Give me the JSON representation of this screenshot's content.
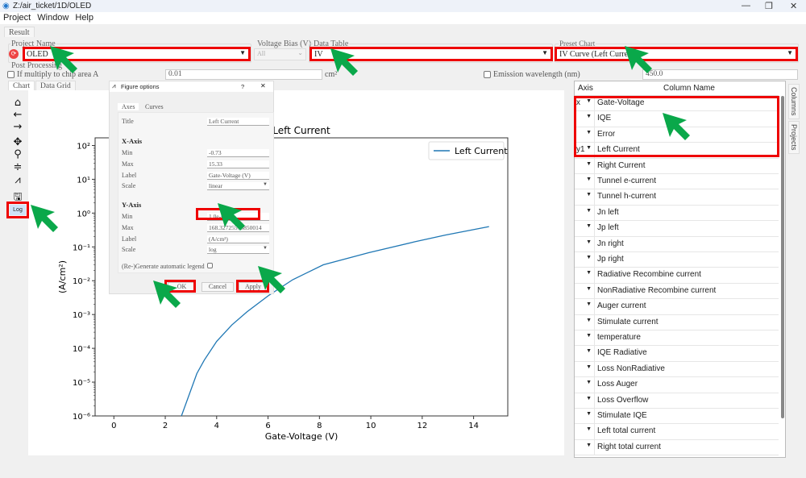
{
  "window": {
    "title": "Z:/air_ticket/1D/OLED",
    "minimize": "—",
    "restore": "❐",
    "close": "✕"
  },
  "menu": [
    "Project",
    "Window",
    "Help"
  ],
  "result_tab": "Result",
  "project": {
    "label": "Project Name",
    "value": "OLED"
  },
  "voltage_bias": {
    "label": "Voltage Bias (V)",
    "value": "All"
  },
  "data_table": {
    "label": "Data Table",
    "value": "IV"
  },
  "preset_chart": {
    "label": "Preset Chart",
    "value": "IV Curve (Left Current)"
  },
  "post_processing": {
    "label": "Post Processing",
    "chip_area_label": "If multiply to chip area A",
    "chip_area_value": "0.01",
    "chip_area_unit": "cm²",
    "chip_area_checked": false,
    "emission_label": "Emission wavelength (nm)",
    "emission_value": "450.0",
    "emission_checked": false
  },
  "view_tabs": [
    "Chart",
    "Data Grid"
  ],
  "toolbar": {
    "log_label": "Log",
    "icons": [
      "home-icon",
      "back-icon",
      "forward-icon",
      "pan-icon",
      "zoom-icon",
      "configure-subplots-icon",
      "figure-options-icon",
      "save-icon"
    ]
  },
  "dialog": {
    "title": "Figure options",
    "help": "?",
    "close": "✕",
    "tabs": [
      "Axes",
      "Curves"
    ],
    "title_label": "Title",
    "title_value": "Left Current",
    "x_header": "X-Axis",
    "x_min_label": "Min",
    "x_min": "-0.73",
    "x_max_label": "Max",
    "x_max": "15.33",
    "x_label_label": "Label",
    "x_label": "Gate-Voltage (V)",
    "x_scale_label": "Scale",
    "x_scale": "linear",
    "y_header": "Y-Axis",
    "y_min_label": "Min",
    "y_min": "1.0e-6",
    "y_max_label": "Max",
    "y_max": "168.32725575850014",
    "y_label_label": "Label",
    "y_label": "(A/cm²)",
    "y_scale_label": "Scale",
    "y_scale": "log",
    "legend_label": "(Re-)Generate automatic legend",
    "ok": "OK",
    "cancel": "Cancel",
    "apply": "Apply"
  },
  "chart_data": {
    "type": "line",
    "title": "Left Current",
    "xlabel": "Gate-Voltage (V)",
    "ylabel": "(A/cm²)",
    "xlim": [
      -0.73,
      15.33
    ],
    "ylim": [
      1e-06,
      168.33
    ],
    "yscale": "log",
    "grid": false,
    "legend": "top-right",
    "xticks": [
      "0",
      "2",
      "4",
      "6",
      "8",
      "10",
      "12",
      "14"
    ],
    "yticks": [
      "10²",
      "10¹",
      "10⁰",
      "10⁻¹",
      "10⁻²",
      "10⁻³",
      "10⁻⁴",
      "10⁻⁵",
      "10⁻⁶"
    ],
    "series": [
      {
        "name": "Left Current",
        "color": "#1f77b4",
        "x": [
          2.63,
          3.23,
          3.52,
          4.0,
          4.59,
          5.18,
          6.01,
          6.96,
          8.15,
          9.93,
          11.7,
          12.9,
          14.6
        ],
        "y": [
          1e-06,
          1.8e-05,
          4.5e-05,
          0.00016,
          0.00049,
          0.0012,
          0.0036,
          0.0107,
          0.0295,
          0.068,
          0.141,
          0.224,
          0.398
        ]
      }
    ]
  },
  "columns_table": {
    "headers": [
      "Axis",
      "Column Name"
    ],
    "rows": [
      {
        "axis": "x",
        "name": "Gate-Voltage"
      },
      {
        "axis": "",
        "name": "IQE"
      },
      {
        "axis": "",
        "name": "Error"
      },
      {
        "axis": "y1",
        "name": "Left Current"
      },
      {
        "axis": "",
        "name": "Right Current"
      },
      {
        "axis": "",
        "name": "Tunnel e-current"
      },
      {
        "axis": "",
        "name": "Tunnel h-current"
      },
      {
        "axis": "",
        "name": "Jn left"
      },
      {
        "axis": "",
        "name": "Jp left"
      },
      {
        "axis": "",
        "name": "Jn right"
      },
      {
        "axis": "",
        "name": "Jp right"
      },
      {
        "axis": "",
        "name": "Radiative Recombine current"
      },
      {
        "axis": "",
        "name": "NonRadiative Recombine current"
      },
      {
        "axis": "",
        "name": "Auger current"
      },
      {
        "axis": "",
        "name": "Stimulate current"
      },
      {
        "axis": "",
        "name": "temperature"
      },
      {
        "axis": "",
        "name": "IQE Radiative"
      },
      {
        "axis": "",
        "name": "Loss NonRadiative"
      },
      {
        "axis": "",
        "name": "Loss Auger"
      },
      {
        "axis": "",
        "name": "Loss Overflow"
      },
      {
        "axis": "",
        "name": "Stimulate IQE"
      },
      {
        "axis": "",
        "name": "Left total current"
      },
      {
        "axis": "",
        "name": "Right total current"
      }
    ]
  },
  "side_tabs": [
    "Columns",
    "Projects"
  ],
  "colors": {
    "highlight": "#e00000",
    "arrow": "#0aa84a",
    "line": "#1f77b4"
  }
}
